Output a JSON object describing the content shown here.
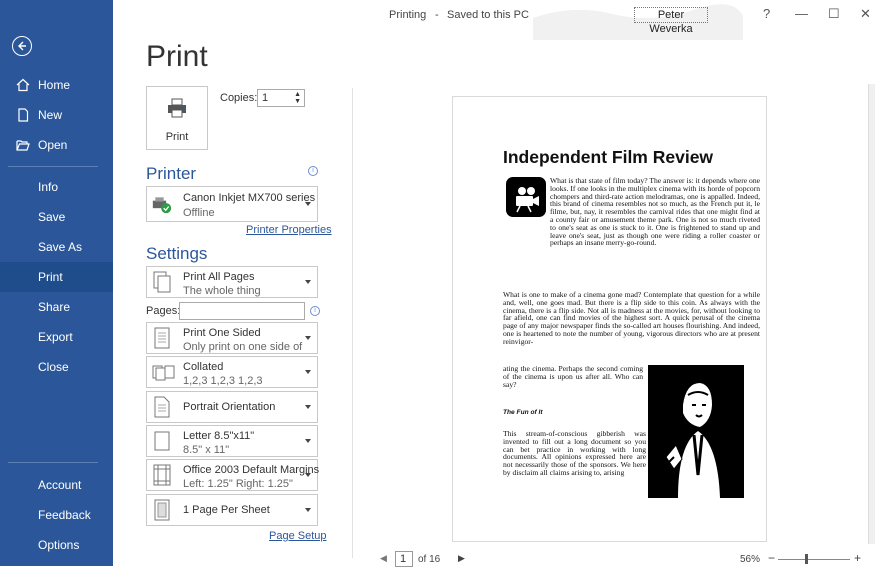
{
  "titlebar": {
    "doc": "Printing",
    "separator": "-",
    "status": "Saved to this PC",
    "user": "Peter Weverka",
    "help": "?",
    "minimize": "—",
    "maximize": "☐",
    "close": "✕"
  },
  "sidebar": {
    "items": [
      {
        "label": "Home"
      },
      {
        "label": "New"
      },
      {
        "label": "Open"
      },
      {
        "label": "Info"
      },
      {
        "label": "Save"
      },
      {
        "label": "Save As"
      },
      {
        "label": "Print"
      },
      {
        "label": "Share"
      },
      {
        "label": "Export"
      },
      {
        "label": "Close"
      },
      {
        "label": "Account"
      },
      {
        "label": "Feedback"
      },
      {
        "label": "Options"
      }
    ],
    "selected": "Print"
  },
  "main": {
    "title": "Print",
    "print_button": "Print",
    "copies_label": "Copies:",
    "copies_value": "1",
    "printer_heading": "Printer",
    "printer_name": "Canon Inkjet MX700 series",
    "printer_status": "Offline",
    "printer_properties": "Printer Properties",
    "settings_heading": "Settings",
    "settings": [
      {
        "t1": "Print All Pages",
        "t2": "The whole thing"
      },
      {
        "t1": "Print One Sided",
        "t2": "Only print on one side of th..."
      },
      {
        "t1": "Collated",
        "t2": "1,2,3   1,2,3   1,2,3"
      },
      {
        "t1": "Portrait Orientation",
        "t2": ""
      },
      {
        "t1": "Letter 8.5\"x11\"",
        "t2": "8.5\" x 11\""
      },
      {
        "t1": "Office 2003 Default Margins",
        "t2": "Left: 1.25\"   Right: 1.25\""
      },
      {
        "t1": "1 Page Per Sheet",
        "t2": ""
      }
    ],
    "pages_label": "Pages:",
    "page_setup": "Page Setup"
  },
  "preview": {
    "title": "Independent Film Review",
    "para1": "What is that state of film today? The answer is: it depends where one looks. If one looks in the multiplex cinema with its horde of popcorn chompers and third-rate action melodramas, one is appalled. Indeed, this brand of cinema resembles not so much, as the French put it, le filme, but, nay, it resembles the carnival rides that one might find at a county fair or amusement theme park. One is not so much riveted to one's seat as one is stuck to it. One is frightened to stand up and leave one's seat, just as though one were riding a roller coaster or perhaps an insane merry-go-round.",
    "para2": "What is one to make of a cinema gone mad? Contemplate that question for a while and, well, one goes mad. But there is a flip side to this coin. As always with the cinema, there is a flip side. Not all is madness at the movies, for, without looking to far afield, one can find movies of the highest sort. A quick perusal of the cinema page of any major newspaper finds the so-called art houses flourishing. And indeed, one is heartened to note the number of young, vigorous directors who are at present reinvigor-",
    "para3": "ating the cinema. Perhaps the second coming of the cinema is upon us after all. Who can say?",
    "subhead": "The Fun of It",
    "para4": "This stream-of-conscious gibberish was invented to fill out a long document so you can bet practice in working with long documents. All opinions expressed here are not necessarily those of the sponsors. We here by disclaim all claims arising to, arising"
  },
  "bottom": {
    "page": "1",
    "of_label": "of 16",
    "zoom": "56%",
    "minus": "−",
    "plus": "+"
  }
}
